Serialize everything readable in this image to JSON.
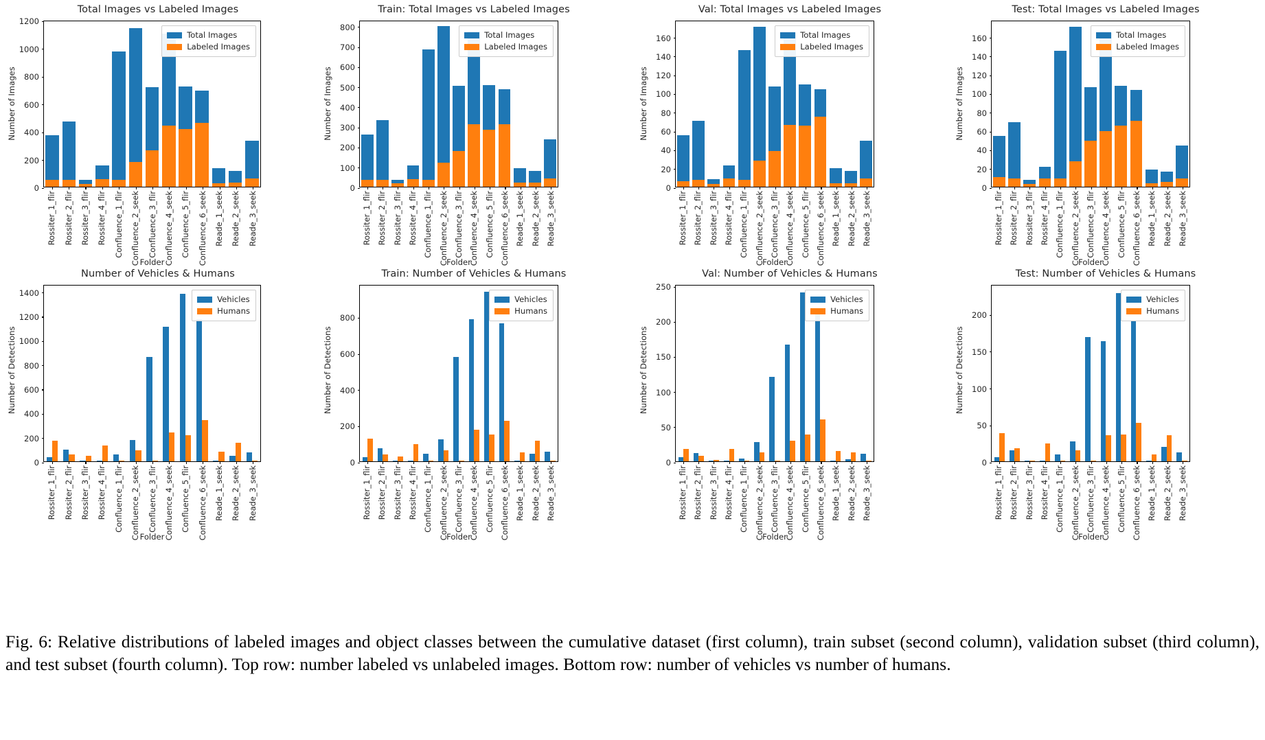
{
  "figure": {
    "caption": "Fig. 6: Relative distributions of labeled images and object classes between the cumulative dataset (first column), train subset (second column), validation subset (third column), and test subset (fourth column). Top row: number labeled vs unlabeled images. Bottom row: number of vehicles vs number of humans."
  },
  "categories": [
    "Rossiter_1_flir",
    "Rossiter_2_flir",
    "Rossiter_3_flir",
    "Rossiter_4_flir",
    "Confluence_1_flir",
    "Confluence_2_seek",
    "Confluence_3_flir",
    "Confluence_4_seek",
    "Confluence_5_flir",
    "Confluence_6_seek",
    "Reade_1_seek",
    "Reade_2_seek",
    "Reade_3_seek"
  ],
  "chart_data": [
    {
      "id": "all_images",
      "type": "bar",
      "stacked": true,
      "title": "Total Images vs Labeled Images",
      "xlabel": "Folder",
      "ylabel": "Number of Images",
      "ylim": [
        0,
        1200
      ],
      "yticks": [
        0,
        200,
        400,
        600,
        800,
        1000,
        1200
      ],
      "grid": false,
      "legend": {
        "position": "upper right",
        "entries": [
          "Total Images",
          "Labeled Images"
        ]
      },
      "categories": [
        "Rossiter_1_flir",
        "Rossiter_2_flir",
        "Rossiter_3_flir",
        "Rossiter_4_flir",
        "Confluence_1_flir",
        "Confluence_2_seek",
        "Confluence_3_flir",
        "Confluence_4_seek",
        "Confluence_5_flir",
        "Confluence_6_seek",
        "Reade_1_seek",
        "Reade_2_seek",
        "Reade_3_seek"
      ],
      "series": [
        {
          "name": "Total Images",
          "color": "#1f77b4",
          "values": [
            372,
            470,
            49,
            153,
            975,
            1143,
            716,
            1101,
            723,
            690,
            131,
            114,
            333
          ]
        },
        {
          "name": "Labeled Images",
          "color": "#ff7f0e",
          "values": [
            48,
            48,
            22,
            55,
            48,
            176,
            260,
            440,
            413,
            458,
            26,
            30,
            60
          ]
        }
      ]
    },
    {
      "id": "train_images",
      "type": "bar",
      "stacked": true,
      "title": "Train: Total Images vs Labeled Images",
      "xlabel": "Folder",
      "ylabel": "Number of Images",
      "ylim": [
        0,
        830
      ],
      "yticks": [
        0,
        100,
        200,
        300,
        400,
        500,
        600,
        700,
        800
      ],
      "grid": false,
      "legend": {
        "position": "upper right",
        "entries": [
          "Total Images",
          "Labeled Images"
        ]
      },
      "categories": [
        "Rossiter_1_flir",
        "Rossiter_2_flir",
        "Rossiter_3_flir",
        "Rossiter_4_flir",
        "Confluence_1_flir",
        "Confluence_2_seek",
        "Confluence_3_flir",
        "Confluence_4_seek",
        "Confluence_5_flir",
        "Confluence_6_seek",
        "Reade_1_seek",
        "Reade_2_seek",
        "Reade_3_seek"
      ],
      "series": [
        {
          "name": "Total Images",
          "color": "#1f77b4",
          "values": [
            260,
            330,
            33,
            107,
            684,
            800,
            502,
            771,
            507,
            484,
            93,
            80,
            236
          ]
        },
        {
          "name": "Labeled Images",
          "color": "#ff7f0e",
          "values": [
            34,
            34,
            16,
            38,
            35,
            121,
            176,
            312,
            282,
            312,
            19,
            21,
            42
          ]
        }
      ]
    },
    {
      "id": "val_images",
      "type": "bar",
      "stacked": true,
      "title": "Val: Total Images vs Labeled Images",
      "xlabel": "Folder",
      "ylabel": "Number of Images",
      "ylim": [
        0,
        178
      ],
      "yticks": [
        0,
        20,
        40,
        60,
        80,
        100,
        120,
        140,
        160
      ],
      "grid": false,
      "legend": {
        "position": "upper right",
        "entries": [
          "Total Images",
          "Labeled Images"
        ]
      },
      "categories": [
        "Rossiter_1_flir",
        "Rossiter_2_flir",
        "Rossiter_3_flir",
        "Rossiter_4_flir",
        "Confluence_1_flir",
        "Confluence_2_seek",
        "Confluence_3_flir",
        "Confluence_4_seek",
        "Confluence_5_flir",
        "Confluence_6_seek",
        "Reade_1_seek",
        "Reade_2_seek",
        "Reade_3_seek"
      ],
      "series": [
        {
          "name": "Total Images",
          "color": "#1f77b4",
          "values": [
            55,
            70,
            8,
            23,
            146,
            171,
            107,
            165,
            109,
            104,
            20,
            17,
            49
          ]
        },
        {
          "name": "Labeled Images",
          "color": "#ff7f0e",
          "values": [
            6,
            7,
            3,
            9,
            7,
            28,
            38,
            66,
            65,
            75,
            4,
            4,
            9
          ]
        }
      ]
    },
    {
      "id": "test_images",
      "type": "bar",
      "stacked": true,
      "title": "Test: Total Images vs Labeled Images",
      "xlabel": "Folder",
      "ylabel": "Number of Images",
      "ylim": [
        0,
        178
      ],
      "yticks": [
        0,
        20,
        40,
        60,
        80,
        100,
        120,
        140,
        160
      ],
      "grid": false,
      "legend": {
        "position": "upper right",
        "entries": [
          "Total Images",
          "Labeled Images"
        ]
      },
      "categories": [
        "Rossiter_1_flir",
        "Rossiter_2_flir",
        "Rossiter_3_flir",
        "Rossiter_4_flir",
        "Confluence_1_flir",
        "Confluence_2_seek",
        "Confluence_3_flir",
        "Confluence_4_seek",
        "Confluence_5_flir",
        "Confluence_6_seek",
        "Reade_1_seek",
        "Reade_2_seek",
        "Reade_3_seek"
      ],
      "series": [
        {
          "name": "Total Images",
          "color": "#1f77b4",
          "values": [
            54,
            69,
            7,
            21,
            145,
            171,
            106,
            164,
            108,
            103,
            18,
            16,
            44
          ]
        },
        {
          "name": "Labeled Images",
          "color": "#ff7f0e",
          "values": [
            10,
            9,
            3,
            9,
            9,
            27,
            49,
            59,
            65,
            70,
            4,
            5,
            9
          ]
        }
      ]
    },
    {
      "id": "all_detections",
      "type": "bar",
      "stacked": false,
      "title": "Number of Vehicles & Humans",
      "xlabel": "Folder",
      "ylabel": "Number of Detections",
      "ylim": [
        0,
        1460
      ],
      "yticks": [
        0,
        200,
        400,
        600,
        800,
        1000,
        1200,
        1400
      ],
      "grid": false,
      "legend": {
        "position": "upper right",
        "entries": [
          "Vehicles",
          "Humans"
        ]
      },
      "categories": [
        "Rossiter_1_flir",
        "Rossiter_2_flir",
        "Rossiter_3_flir",
        "Rossiter_4_flir",
        "Confluence_1_flir",
        "Confluence_2_seek",
        "Confluence_3_flir",
        "Confluence_4_seek",
        "Confluence_5_flir",
        "Confluence_6_seek",
        "Reade_1_seek",
        "Reade_2_seek",
        "Reade_3_seek"
      ],
      "series": [
        {
          "name": "Vehicles",
          "color": "#1f77b4",
          "values": [
            36,
            98,
            2,
            3,
            57,
            176,
            863,
            1112,
            1383,
            1172,
            3,
            43,
            72
          ]
        },
        {
          "name": "Humans",
          "color": "#ff7f0e",
          "values": [
            172,
            54,
            43,
            131,
            4,
            92,
            1,
            238,
            215,
            338,
            78,
            152,
            2
          ]
        }
      ]
    },
    {
      "id": "train_detections",
      "type": "bar",
      "stacked": false,
      "title": "Train: Number of Vehicles & Humans",
      "xlabel": "Folder",
      "ylabel": "Number of Detections",
      "ylim": [
        0,
        980
      ],
      "yticks": [
        0,
        200,
        400,
        600,
        800
      ],
      "grid": false,
      "legend": {
        "position": "upper right",
        "entries": [
          "Vehicles",
          "Humans"
        ]
      },
      "categories": [
        "Rossiter_1_flir",
        "Rossiter_2_flir",
        "Rossiter_3_flir",
        "Rossiter_4_flir",
        "Confluence_1_flir",
        "Confluence_2_seek",
        "Confluence_3_flir",
        "Confluence_4_seek",
        "Confluence_5_flir",
        "Confluence_6_seek",
        "Reade_1_seek",
        "Reade_2_seek",
        "Reade_3_seek"
      ],
      "series": [
        {
          "name": "Vehicles",
          "color": "#1f77b4",
          "values": [
            24,
            71,
            1,
            2,
            41,
            120,
            578,
            785,
            938,
            765,
            2,
            40,
            52
          ]
        },
        {
          "name": "Humans",
          "color": "#ff7f0e",
          "values": [
            124,
            37,
            25,
            95,
            3,
            62,
            1,
            175,
            148,
            224,
            48,
            113,
            1
          ]
        }
      ]
    },
    {
      "id": "val_detections",
      "type": "bar",
      "stacked": false,
      "title": "Val: Number of Vehicles & Humans",
      "xlabel": "Folder",
      "ylabel": "Number of Detections",
      "ylim": [
        0,
        252
      ],
      "yticks": [
        0,
        50,
        100,
        150,
        200,
        250
      ],
      "grid": false,
      "legend": {
        "position": "upper right",
        "entries": [
          "Vehicles",
          "Humans"
        ]
      },
      "categories": [
        "Rossiter_1_flir",
        "Rossiter_2_flir",
        "Rossiter_3_flir",
        "Rossiter_4_flir",
        "Confluence_1_flir",
        "Confluence_2_seek",
        "Confluence_3_flir",
        "Confluence_4_seek",
        "Confluence_5_flir",
        "Confluence_6_seek",
        "Reade_1_seek",
        "Reade_2_seek",
        "Reade_3_seek"
      ],
      "series": [
        {
          "name": "Vehicles",
          "color": "#1f77b4",
          "values": [
            6,
            12,
            1,
            1,
            4,
            27,
            120,
            166,
            240,
            215,
            1,
            3,
            11
          ]
        },
        {
          "name": "Humans",
          "color": "#ff7f0e",
          "values": [
            18,
            8,
            2,
            18,
            1,
            13,
            1,
            29,
            38,
            60,
            15,
            13,
            1
          ]
        }
      ]
    },
    {
      "id": "test_detections",
      "type": "bar",
      "stacked": false,
      "title": "Test: Number of Vehicles & Humans",
      "xlabel": "Folder",
      "ylabel": "Number of Detections",
      "ylim": [
        0,
        240
      ],
      "yticks": [
        0,
        50,
        100,
        150,
        200
      ],
      "grid": false,
      "legend": {
        "position": "upper right",
        "entries": [
          "Vehicles",
          "Humans"
        ]
      },
      "categories": [
        "Rossiter_1_flir",
        "Rossiter_2_flir",
        "Rossiter_3_flir",
        "Rossiter_4_flir",
        "Confluence_1_flir",
        "Confluence_2_seek",
        "Confluence_3_flir",
        "Confluence_4_seek",
        "Confluence_5_flir",
        "Confluence_6_seek",
        "Reade_1_seek",
        "Reade_2_seek",
        "Reade_3_seek"
      ],
      "series": [
        {
          "name": "Vehicles",
          "color": "#1f77b4",
          "values": [
            6,
            15,
            1,
            1,
            9,
            27,
            168,
            163,
            228,
            190,
            1,
            20,
            12
          ]
        },
        {
          "name": "Humans",
          "color": "#ff7f0e",
          "values": [
            38,
            18,
            1,
            24,
            1,
            15,
            1,
            35,
            36,
            52,
            9,
            35,
            1
          ]
        }
      ]
    }
  ]
}
